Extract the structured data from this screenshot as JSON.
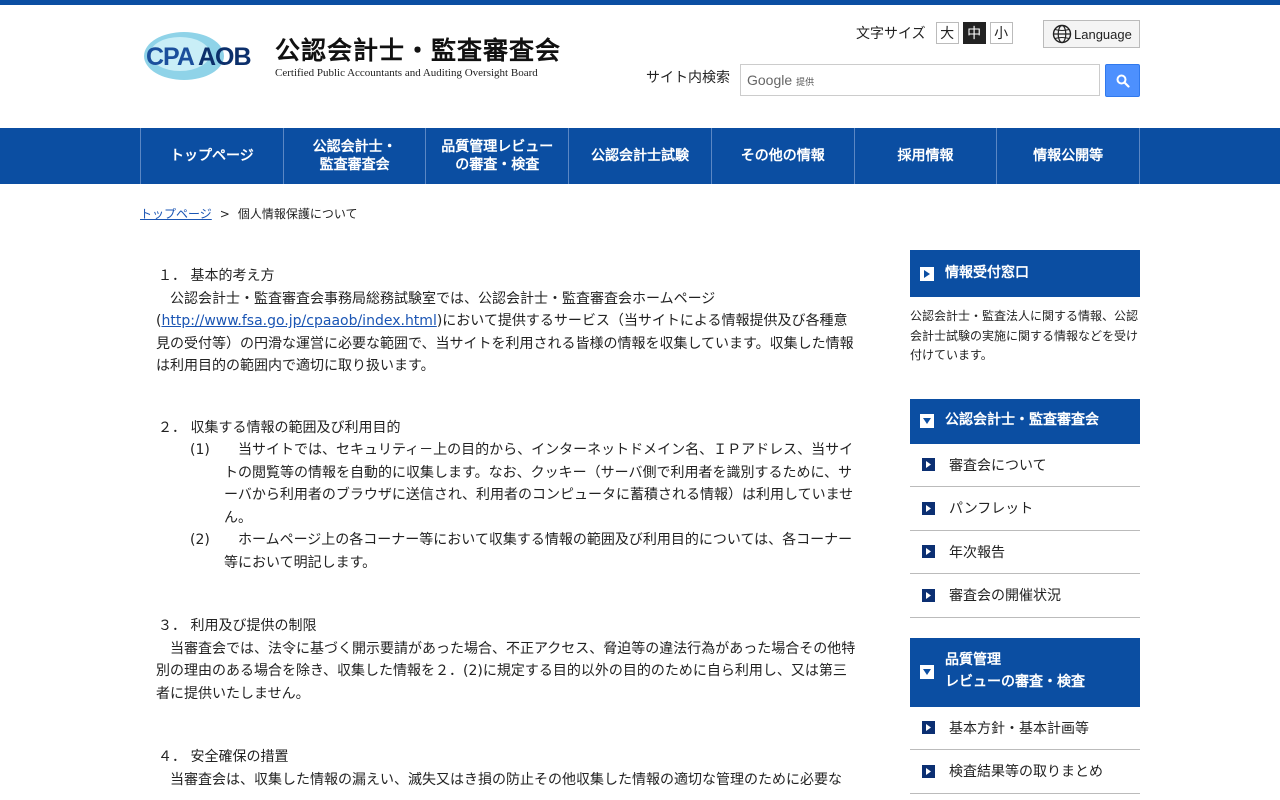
{
  "header": {
    "logo_mark_text": "CPAAOB",
    "title_ja": "公認会計士・監査審査会",
    "title_en": "Certified Public Accountants and Auditing Oversight Board",
    "font_size_label": "文字サイズ",
    "font_sizes": [
      "大",
      "中",
      "小"
    ],
    "language_label": "Language",
    "search_label": "サイト内検索",
    "search_brand": "Google",
    "search_brand_sub": "提供"
  },
  "gnav": [
    "トップページ",
    "公認会計士・\n監査審査会",
    "品質管理レビュー\nの審査・検査",
    "公認会計士試験",
    "その他の情報",
    "採用情報",
    "情報公開等"
  ],
  "breadcrumb": {
    "home": "トップページ",
    "separator": ">",
    "current": "個人情報保護について"
  },
  "main": {
    "s1_title": "１． 基本的考え方",
    "s1_p_before": "公認会計士・監査審査会事務局総務試験室では、公認会計士・監査審査会ホームページ(",
    "s1_link": "http://www.fsa.go.jp/cpaaob/index.html",
    "s1_p_after": ")において提供するサービス（当サイトによる情報提供及び各種意見の受付等）の円滑な運営に必要な範囲で、当サイトを利用される皆様の情報を収集しています。収集した情報は利用目的の範囲内で適切に取り扱います。",
    "s2_title": "２． 収集する情報の範囲及び利用目的",
    "s2_item1_num": "(1)",
    "s2_item1_text": "当サイトでは、セキュリティ－上の目的から、インターネットドメイン名、ＩＰアドレス、当サイトの閲覧等の情報を自動的に収集します。なお、クッキー（サーバ側で利用者を識別するために、サーバから利用者のブラウザに送信され、利用者のコンピュータに蓄積される情報）は利用していません。",
    "s2_item2_num": "(2)",
    "s2_item2_text": "ホームページ上の各コーナー等において収集する情報の範囲及び利用目的については、各コーナー等において明記します。",
    "s3_title": "３． 利用及び提供の制限",
    "s3_p": "当審査会では、法令に基づく開示要請があった場合、不正アクセス、脅迫等の違法行為があった場合その他特別の理由のある場合を除き、収集した情報を２．(2)に規定する目的以外の目的のために自ら利用し、又は第三者に提供いたしません。",
    "s4_title": "４． 安全確保の措置",
    "s4_p": "当審査会は、収集した情報の漏えい、滅失又はき損の防止その他収集した情報の適切な管理のために必要な"
  },
  "sidebar": {
    "box1_title": "情報受付窓口",
    "box1_desc": "公認会計士・監査法人に関する情報、公認会計士試験の実施に関する情報などを受け付けています。",
    "box2_title": "公認会計士・監査審査会",
    "box2_links": [
      "審査会について",
      "パンフレット",
      "年次報告",
      "審査会の開催状況"
    ],
    "box3_title_line1": "品質管理",
    "box3_title_line2": "レビューの審査・検査",
    "box3_links": [
      "基本方針・基本計画等",
      "検査結果等の取りまとめ"
    ]
  },
  "colors": {
    "brand_blue": "#0b4ea2",
    "link_blue": "#1a55b4",
    "search_button": "#4d90fe"
  }
}
